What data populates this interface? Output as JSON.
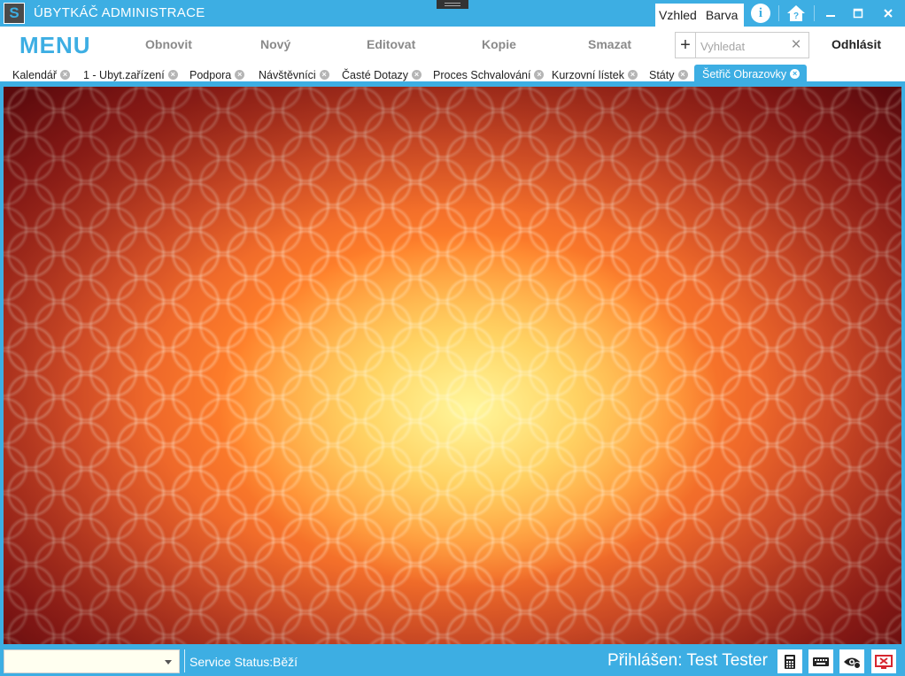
{
  "window": {
    "title": "ÚBYTKÁČ ADMINISTRACE",
    "logo_letter": "S",
    "view_label": "Vzhled",
    "color_label": "Barva"
  },
  "toolbar": {
    "menu_label": "MENU",
    "refresh_label": "Obnovit",
    "new_label": "Nový",
    "edit_label": "Editovat",
    "copy_label": "Kopie",
    "delete_label": "Smazat",
    "add_symbol": "+",
    "search_placeholder": "Vyhledat",
    "search_value": "",
    "logout_label": "Odhlásit"
  },
  "tabs": [
    {
      "label": "Kalendář",
      "active": false
    },
    {
      "label": "1 - Ubyt.zařízení",
      "active": false
    },
    {
      "label": "Podpora",
      "active": false
    },
    {
      "label": "Návštěvníci",
      "active": false
    },
    {
      "label": "Časté Dotazy",
      "active": false
    },
    {
      "label": "Proces Schvalování",
      "active": false
    },
    {
      "label": "Kurzovní lístek",
      "active": false
    },
    {
      "label": "Státy",
      "active": false
    },
    {
      "label": "Šetřič Obrazovky",
      "active": true
    }
  ],
  "status": {
    "select_value": "",
    "service_label": "Service Status:",
    "service_value": "Běží",
    "logged_in": "Přihlášen: Test Tester"
  },
  "colors": {
    "accent": "#3daee3",
    "status_select_bg": "#fffff0"
  },
  "icons": {
    "info": "info-icon",
    "help": "home-help-icon",
    "calculator": "calculator-icon",
    "keyboard": "keyboard-icon",
    "eye": "eye-refresh-icon",
    "screen": "screen-off-icon"
  }
}
